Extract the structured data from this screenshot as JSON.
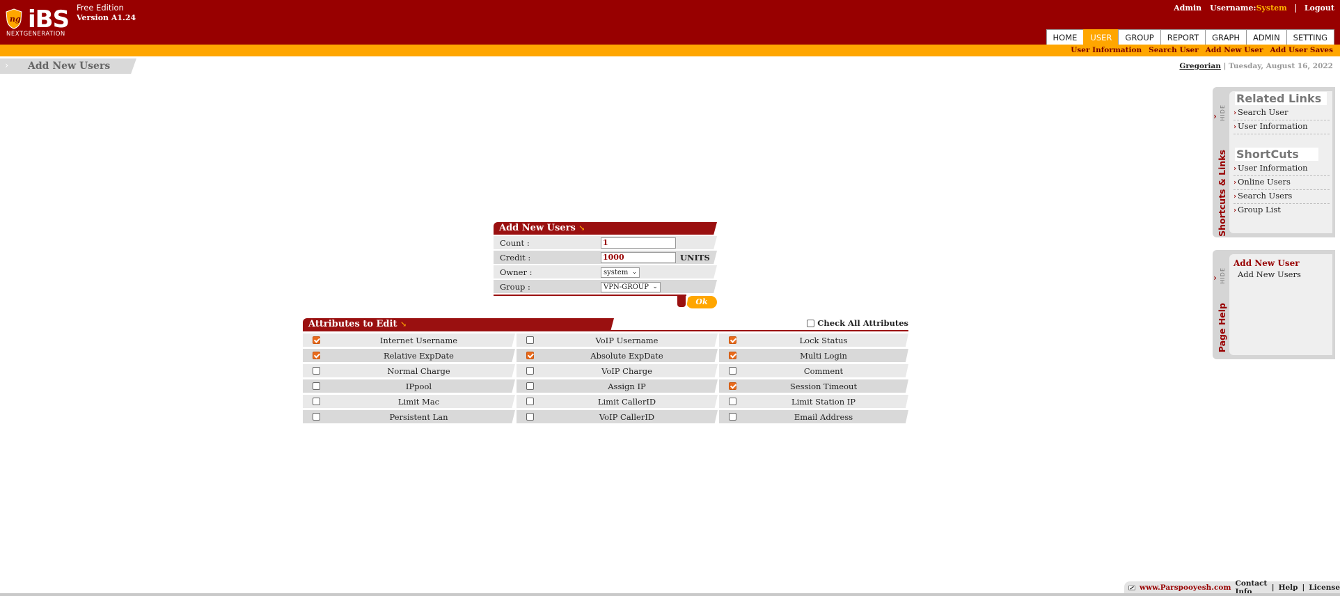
{
  "header": {
    "logo_text": "iBS",
    "logo_tagline": "NEXTGENERATION",
    "edition": "Free Edition",
    "version": "Version A1.24",
    "admin": "Admin",
    "username_label": "Username:",
    "username_value": "System",
    "logout": "Logout",
    "colors": {
      "primary": "#980000",
      "accent": "#ffa600"
    }
  },
  "nav": {
    "tabs": [
      {
        "label": "HOME"
      },
      {
        "label": "USER",
        "active": true
      },
      {
        "label": "GROUP"
      },
      {
        "label": "REPORT"
      },
      {
        "label": "GRAPH"
      },
      {
        "label": "ADMIN"
      },
      {
        "label": "SETTING"
      }
    ],
    "sub_links": [
      "User Information",
      "Search User",
      "Add New User",
      "Add User Saves"
    ]
  },
  "page": {
    "title": "Add New Users",
    "calendar": "Gregorian",
    "date": "| Tuesday, August 16, 2022"
  },
  "related": {
    "hide_label": "HIDE",
    "vertical_title": "Shortcuts & Links",
    "title": "Related Links",
    "links": [
      "Search User",
      "User Information"
    ],
    "shortcuts_title": "ShortCuts",
    "shortcuts": [
      "User Information",
      "Online Users",
      "Search Users",
      "Group List"
    ]
  },
  "help": {
    "hide_label": "HIDE",
    "vertical_title": "Page Help",
    "title": "Add New User",
    "subtitle": "Add New Users"
  },
  "form": {
    "title": "Add New Users",
    "count_label": "Count :",
    "count_value": "1",
    "credit_label": "Credit :",
    "credit_value": "1000",
    "credit_unit": "UNITS",
    "owner_label": "Owner :",
    "owner_value": "system",
    "group_label": "Group :",
    "group_value": "VPN-GROUP",
    "ok": "Ok"
  },
  "attributes": {
    "title": "Attributes to Edit",
    "check_all": "Check All Attributes",
    "rows": [
      [
        {
          "label": "Internet Username",
          "checked": true
        },
        {
          "label": "VoIP Username",
          "checked": false
        },
        {
          "label": "Lock Status",
          "checked": true
        }
      ],
      [
        {
          "label": "Relative ExpDate",
          "checked": true
        },
        {
          "label": "Absolute ExpDate",
          "checked": true
        },
        {
          "label": "Multi Login",
          "checked": true
        }
      ],
      [
        {
          "label": "Normal Charge",
          "checked": false
        },
        {
          "label": "VoIP Charge",
          "checked": false
        },
        {
          "label": "Comment",
          "checked": false
        }
      ],
      [
        {
          "label": "IPpool",
          "checked": false
        },
        {
          "label": "Assign IP",
          "checked": false
        },
        {
          "label": "Session Timeout",
          "checked": true
        }
      ],
      [
        {
          "label": "Limit Mac",
          "checked": false
        },
        {
          "label": "Limit CallerID",
          "checked": false
        },
        {
          "label": "Limit Station IP",
          "checked": false
        }
      ],
      [
        {
          "label": "Persistent Lan",
          "checked": false
        },
        {
          "label": "VoIP CallerID",
          "checked": false
        },
        {
          "label": "Email Address",
          "checked": false
        }
      ]
    ]
  },
  "footer": {
    "site": "www.Parspooyesh.com",
    "contact": "Contact Info",
    "help": "Help",
    "license": "License"
  }
}
